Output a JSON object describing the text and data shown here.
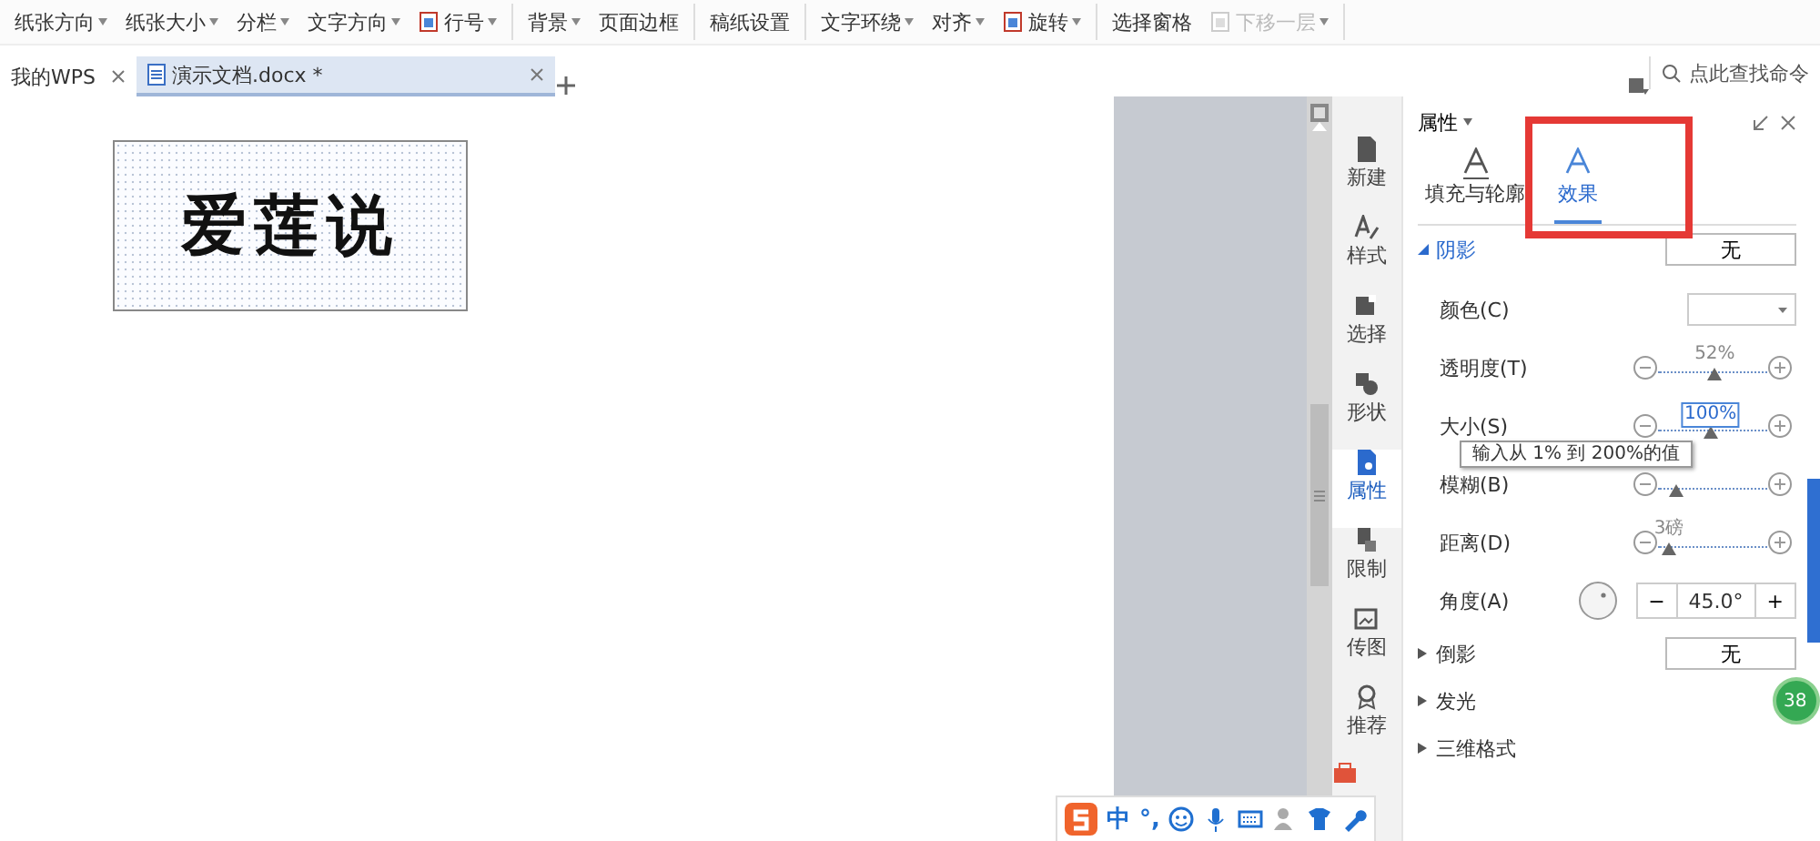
{
  "toolbar": {
    "groups": [
      [
        {
          "kind": "text",
          "label": "纸张方向",
          "dropdown": true,
          "disabled": false
        },
        {
          "kind": "text",
          "label": "纸张大小",
          "dropdown": true,
          "disabled": false
        },
        {
          "kind": "text",
          "label": "分栏",
          "dropdown": true,
          "disabled": false
        },
        {
          "kind": "text",
          "label": "文字方向",
          "dropdown": true,
          "disabled": false
        },
        {
          "kind": "icon",
          "label": "行号",
          "dropdown": true,
          "disabled": false
        }
      ],
      [
        {
          "kind": "text",
          "label": "背景",
          "dropdown": true,
          "disabled": false
        },
        {
          "kind": "text",
          "label": "页面边框",
          "dropdown": false,
          "disabled": false
        }
      ],
      [
        {
          "kind": "text",
          "label": "稿纸设置",
          "dropdown": false,
          "disabled": false
        }
      ],
      [
        {
          "kind": "text",
          "label": "文字环绕",
          "dropdown": true,
          "disabled": false
        },
        {
          "kind": "text",
          "label": "对齐",
          "dropdown": true,
          "disabled": false
        },
        {
          "kind": "icon",
          "label": "旋转",
          "dropdown": true,
          "disabled": false
        }
      ],
      [
        {
          "kind": "text",
          "label": "选择窗格",
          "dropdown": false,
          "disabled": false
        },
        {
          "kind": "icon",
          "label": "下移一层",
          "dropdown": true,
          "disabled": true
        }
      ]
    ]
  },
  "tabs": [
    {
      "label": "我的WPS",
      "selected": false
    },
    {
      "label": "演示文档.docx *",
      "selected": true
    }
  ],
  "search": {
    "placeholder": "点此查找命令"
  },
  "document": {
    "text_box": "爱莲说"
  },
  "sidebar": {
    "items": [
      {
        "label": "新建",
        "selected": false
      },
      {
        "label": "样式",
        "selected": false
      },
      {
        "label": "选择",
        "selected": false
      },
      {
        "label": "形状",
        "selected": false
      },
      {
        "label": "属性",
        "selected": true
      },
      {
        "label": "限制",
        "selected": false
      },
      {
        "label": "传图",
        "selected": false
      },
      {
        "label": "推荐",
        "selected": false
      }
    ]
  },
  "panel": {
    "title": "属性",
    "tabs": [
      {
        "label": "填充与轮廓",
        "selected": false
      },
      {
        "label": "效果",
        "selected": true
      }
    ],
    "sections": [
      {
        "label": "阴影",
        "expanded": true,
        "value": "无"
      },
      {
        "label": "倒影",
        "expanded": false,
        "value": "无"
      },
      {
        "label": "发光",
        "expanded": false
      },
      {
        "label": "三维格式",
        "expanded": false
      }
    ],
    "shadow_rows": [
      {
        "kind": "dropdown",
        "label": "颜色(C)"
      },
      {
        "kind": "slider",
        "label": "透明度(T)",
        "level": 0.52,
        "reading": "52%",
        "editing": false
      },
      {
        "kind": "slider",
        "label": "大小(S)",
        "level": 0.48,
        "reading": "100%",
        "editing": true
      },
      {
        "kind": "slider",
        "label": "模糊(B)",
        "level": 0.17
      },
      {
        "kind": "slider",
        "label": "距离(D)",
        "level": 0.1,
        "reading": "3磅",
        "editing": false
      },
      {
        "kind": "angle",
        "label": "角度(A)",
        "value": "45.0°",
        "minus": "−",
        "plus": "+"
      }
    ],
    "tooltip": "输入从 1% 到 200%的值"
  },
  "badge": "38",
  "ime_bar": {
    "items": [
      "中",
      "°,"
    ]
  }
}
